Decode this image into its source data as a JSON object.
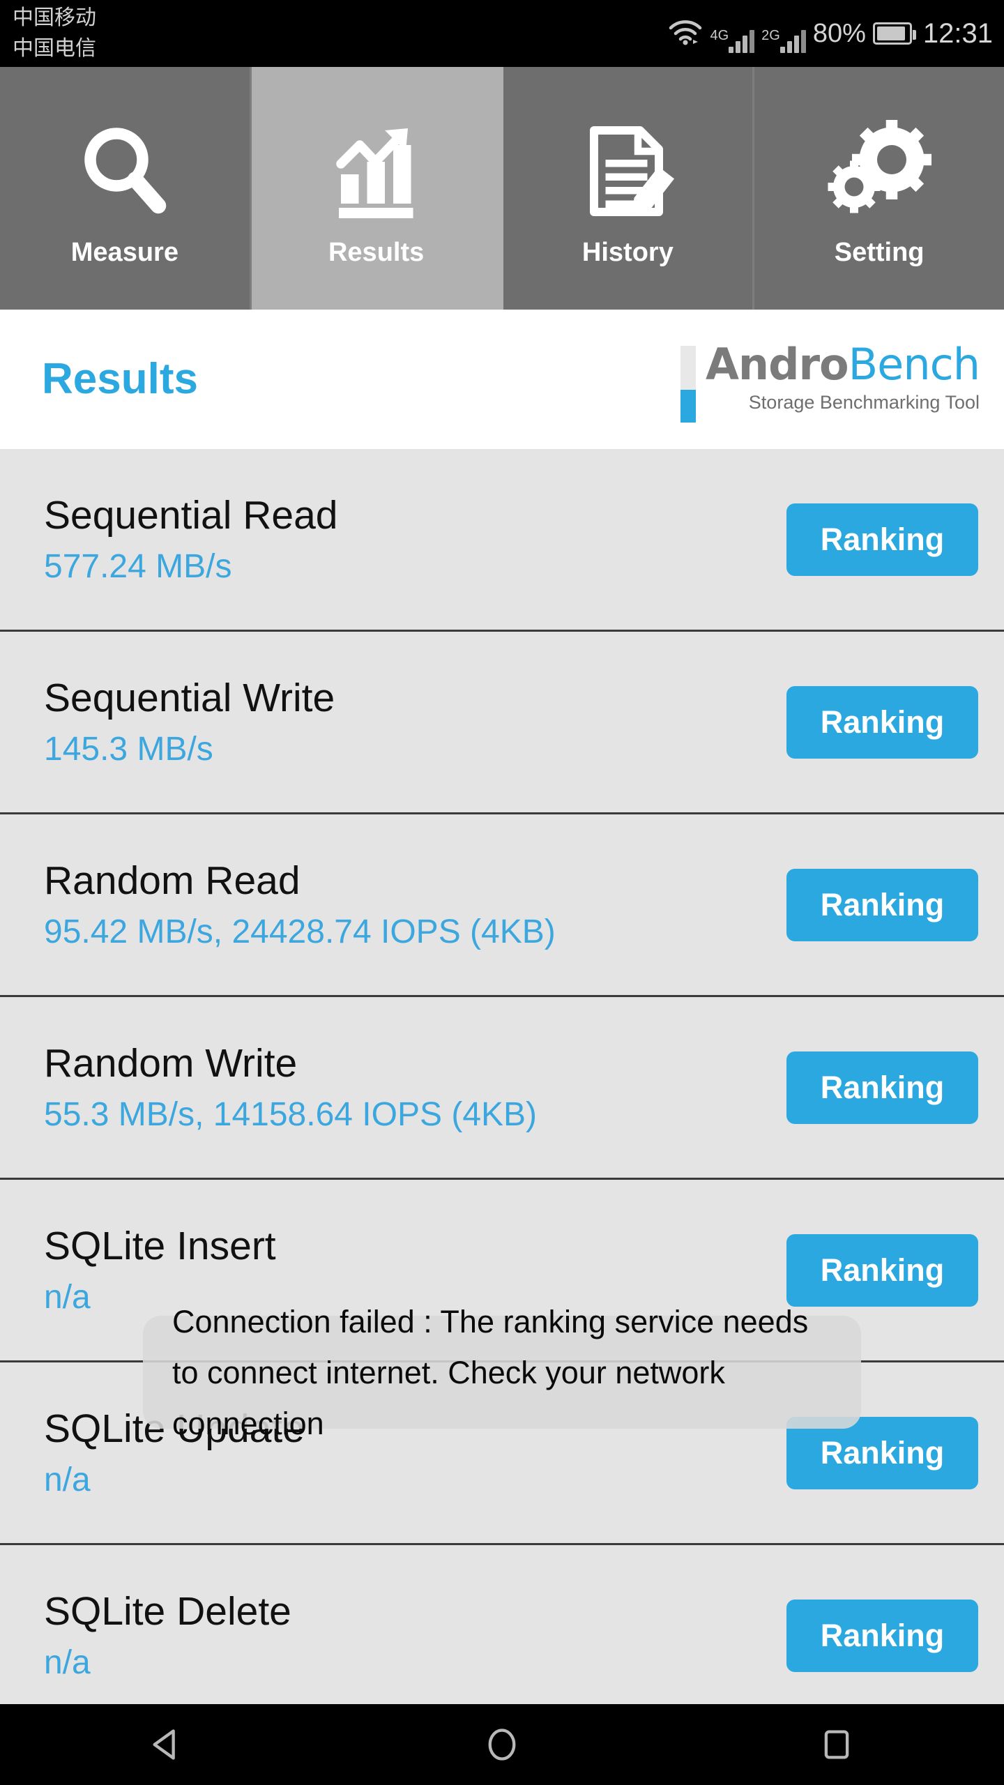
{
  "status_bar": {
    "carriers": [
      "中国移动",
      "中国电信"
    ],
    "wifi_icon": "wifi-icon",
    "signal_1": {
      "label": "4G",
      "icon": "signal-bars-icon"
    },
    "signal_2": {
      "label": "2G",
      "icon": "signal-bars-icon"
    },
    "battery_percent": "80%",
    "battery_icon": "battery-icon",
    "time": "12:31"
  },
  "tabs": [
    {
      "label": "Measure",
      "icon": "magnifier-icon",
      "active": false
    },
    {
      "label": "Results",
      "icon": "bar-chart-arrow-icon",
      "active": true
    },
    {
      "label": "History",
      "icon": "document-pencil-icon",
      "active": false
    },
    {
      "label": "Setting",
      "icon": "gears-icon",
      "active": false
    }
  ],
  "header": {
    "title": "Results",
    "logo_andro": "Andro",
    "logo_bench": "Bench",
    "logo_tagline": "Storage Benchmarking Tool"
  },
  "colors": {
    "accent_blue": "#2ca8e0",
    "value_blue": "#3ba7de",
    "tab_inactive": "#6e6e6e",
    "tab_active": "#b1b1b1",
    "row_bg": "#e4e4e4",
    "logo_gray": "#7b7b7b"
  },
  "results": [
    {
      "title": "Sequential Read",
      "value": "577.24 MB/s",
      "button": "Ranking"
    },
    {
      "title": "Sequential Write",
      "value": "145.3 MB/s",
      "button": "Ranking"
    },
    {
      "title": "Random Read",
      "value": "95.42 MB/s, 24428.74 IOPS (4KB)",
      "button": "Ranking"
    },
    {
      "title": "Random Write",
      "value": "55.3 MB/s, 14158.64 IOPS (4KB)",
      "button": "Ranking"
    },
    {
      "title": "SQLite Insert",
      "value": "n/a",
      "button": "Ranking"
    },
    {
      "title": "SQLite Update",
      "value": "n/a",
      "button": "Ranking"
    },
    {
      "title": "SQLite Delete",
      "value": "n/a",
      "button": "Ranking"
    }
  ],
  "toast": {
    "message": "Connection failed : The ranking service needs to connect internet. Check your network connection"
  },
  "nav_bar": {
    "back": "back-triangle-icon",
    "home": "home-circle-icon",
    "recents": "recents-square-icon"
  }
}
